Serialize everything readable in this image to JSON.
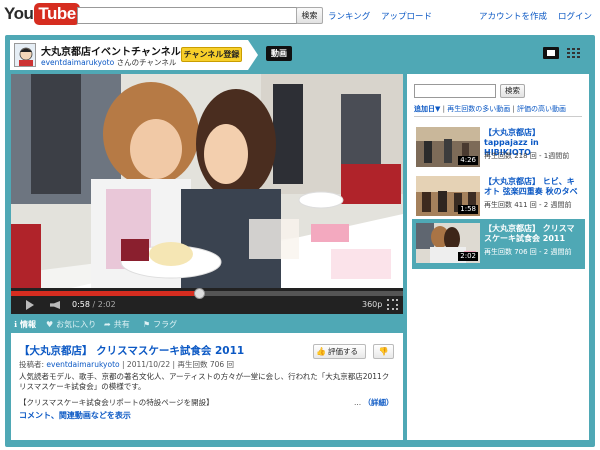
{
  "header": {
    "logo_you": "You",
    "logo_tube": "Tube",
    "search_button": "検索",
    "nav": [
      "ランキング",
      "アップロード",
      "アカウントを作成",
      "ログイン"
    ]
  },
  "channel": {
    "title": "大丸京都店イベントチャンネル",
    "user": "eventdaimarukyoto",
    "user_suffix": "さんのチャンネル",
    "subscribe": "チャンネル登録",
    "tab_video": "動画"
  },
  "player": {
    "current_time": "0:58",
    "separator": " / ",
    "duration": "2:02",
    "progress": 0.48,
    "quality": "360p"
  },
  "actions": {
    "info": "情報",
    "favorite": "お気に入り",
    "share": "共有",
    "flag": "フラグ"
  },
  "video": {
    "title": "【大丸京都店】 クリスマスケーキ試食会 2011",
    "meta_label": "投稿者:",
    "uploader": "eventdaimarukyoto",
    "date": "2011/10/22",
    "views": "再生回数 706 回",
    "like_button": "評価する",
    "description": "人気読者モデル、歌手、京都の著名文化人、アーティストの方々が一堂に会し、行われた「大丸京都店2011クリスマスケーキ試食会」の模様です。",
    "description2": "【クリスマスケーキ試食会リポートの特設ページを開設】",
    "more_ellipsis": "...",
    "more_label": "（詳細）",
    "comments_link": "コメント、関連動画などを表示"
  },
  "sidebar": {
    "search_button": "検索",
    "sort_label": "追加日",
    "sort_arrow": "▼",
    "sort_option1": "再生回数の多い動画",
    "sort_option2": "評価の高い動画",
    "items": [
      {
        "title": "【大丸京都店】 tappajazz in HIBIKIOTO",
        "meta1": "再生回数 218 回",
        "meta2": "1週間前",
        "duration": "4:26"
      },
      {
        "title": "【大丸京都店】 ヒビ、キオト 弦楽四重奏 秋のタベ",
        "meta1": "再生回数 411 回",
        "meta2": "2 週間前",
        "duration": "1:58"
      },
      {
        "title": "【大丸京都店】 クリスマスケーキ試食会 2011",
        "meta1": "再生回数 706 回",
        "meta2": "2 週間前",
        "duration": "2:02"
      }
    ]
  },
  "colors": {
    "frame": "#4fa8b5",
    "link": "#0b58c4",
    "progress": "#d62d20"
  }
}
